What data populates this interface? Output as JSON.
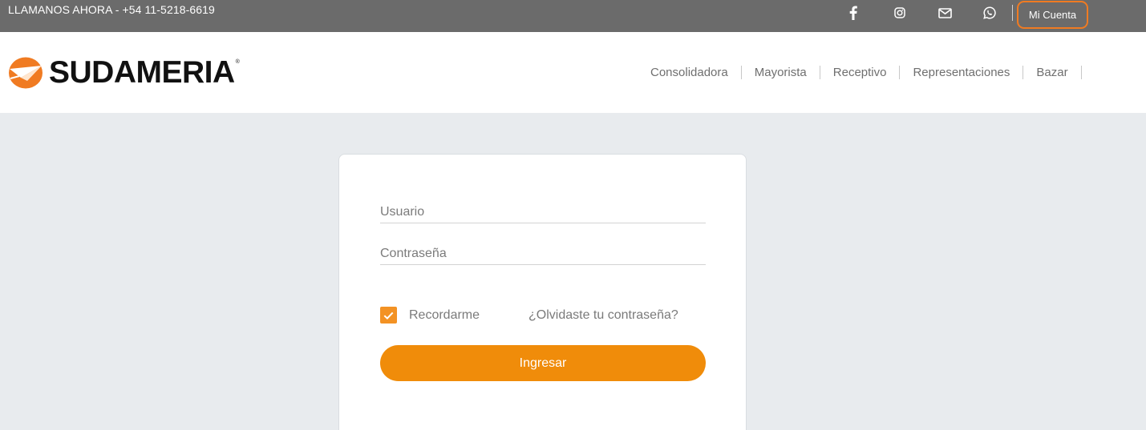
{
  "topbar": {
    "phone_text": "LLAMANOS AHORA - +54 11-5218-6619",
    "social_icons": [
      "facebook-icon",
      "instagram-icon",
      "mail-icon",
      "whatsapp-icon"
    ],
    "account_label": "Mi Cuenta",
    "highlight_color": "#f07b22"
  },
  "header": {
    "logo_text": "SUDAMERIA",
    "logo_registered": "®",
    "nav": [
      "Consolidadora",
      "Mayorista",
      "Receptivo",
      "Representaciones",
      "Bazar"
    ]
  },
  "login": {
    "username_placeholder": "Usuario",
    "password_placeholder": "Contraseña",
    "remember_label": "Recordarme",
    "remember_checked": true,
    "forgot_label": "¿Olvidaste tu contraseña?",
    "submit_label": "Ingresar",
    "accent_color": "#f08c0a"
  }
}
